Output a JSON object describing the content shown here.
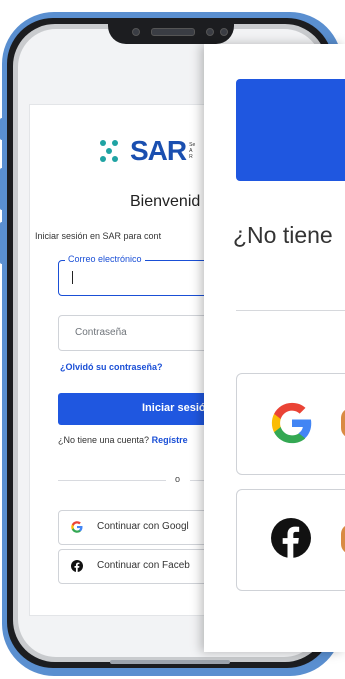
{
  "login": {
    "logo": "SAR",
    "welcome": "Bienvenid",
    "subtitle": "Iniciar sesión en SAR para cont",
    "email_label": "Correo electrónico",
    "password_placeholder": "Contraseña",
    "forgot": "¿Olvidó su contraseña?",
    "login_button": "Iniciar sesió",
    "no_account": "¿No tiene una cuenta?",
    "register_link": "Regístre",
    "divider": "o",
    "google_button": "Continuar con Googl",
    "facebook_button": "Continuar con Faceb"
  },
  "zoom": {
    "no_account": "¿No tiene"
  },
  "colors": {
    "primary": "#1f57e0",
    "link": "#1a4fd6",
    "logo_blue": "#1a4fb0",
    "logo_teal": "#1fa3a3",
    "phone_frame": "#5a8fd0"
  }
}
